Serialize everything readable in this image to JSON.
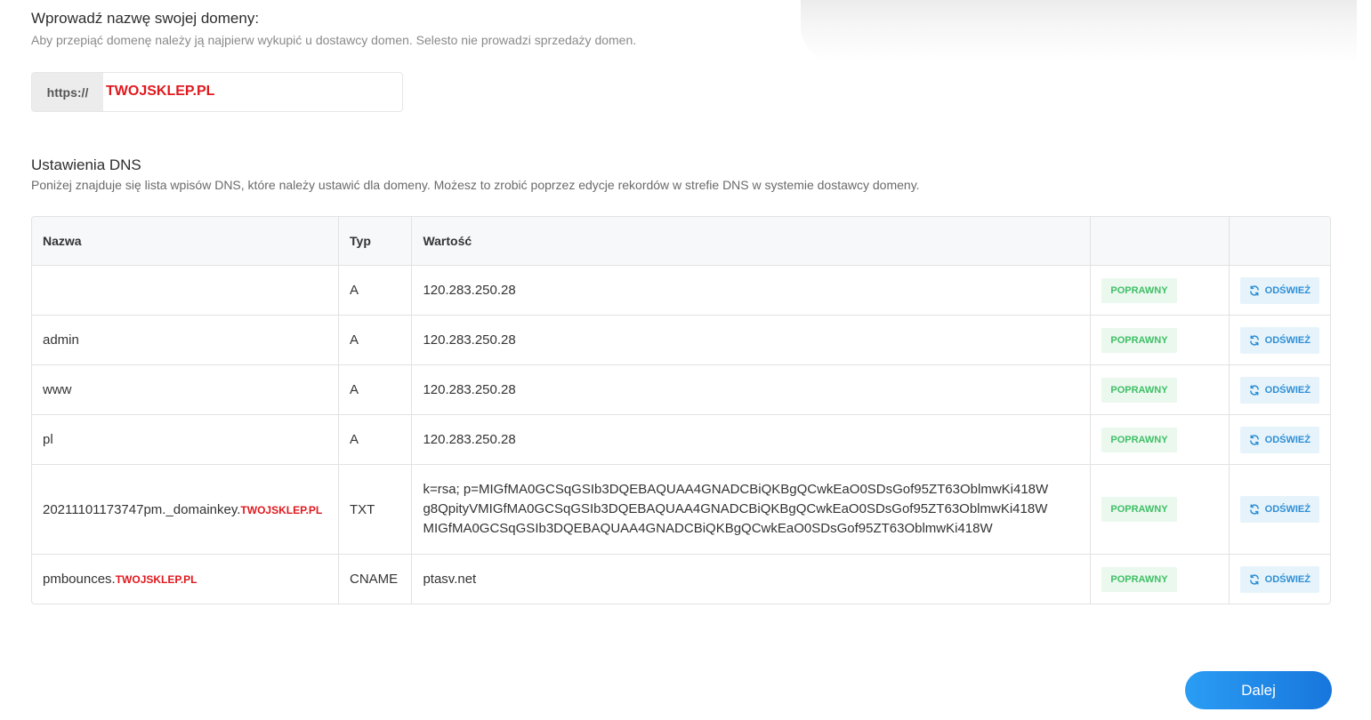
{
  "domain_section": {
    "title": "Wprowadź nazwę swojej domeny:",
    "subtitle": "Aby przepiąć domenę należy ją najpierw wykupić u dostawcy domen. Selesto nie prowadzi sprzedaży domen.",
    "prefix": "https://",
    "value": "TWOJSKLEP.PL"
  },
  "dns_section": {
    "title": "Ustawienia DNS",
    "subtitle": "Poniżej znajduje się lista wpisów DNS, które należy ustawić dla domeny. Możesz to zrobić poprzez edycje rekordów w strefie DNS w systemie dostawcy domeny.",
    "headers": {
      "name": "Nazwa",
      "type": "Typ",
      "value": "Wartość"
    },
    "rows": [
      {
        "name": "",
        "name_domain": "",
        "type": "A",
        "value_lines": [
          "120.283.250.28"
        ],
        "status": "POPRAWNY",
        "action": "ODŚWIEŻ"
      },
      {
        "name": "admin",
        "name_domain": "",
        "type": "A",
        "value_lines": [
          "120.283.250.28"
        ],
        "status": "POPRAWNY",
        "action": "ODŚWIEŻ"
      },
      {
        "name": "www",
        "name_domain": "",
        "type": "A",
        "value_lines": [
          "120.283.250.28"
        ],
        "status": "POPRAWNY",
        "action": "ODŚWIEŻ"
      },
      {
        "name": "pl",
        "name_domain": "",
        "type": "A",
        "value_lines": [
          "120.283.250.28"
        ],
        "status": "POPRAWNY",
        "action": "ODŚWIEŻ"
      },
      {
        "name": "20211101173747pm._domainkey.",
        "name_domain": "TWOJSKLEP.PL",
        "type": "TXT",
        "value_lines": [
          "k=rsa; p=MIGfMA0GCSqGSIb3DQEBAQUAA4GNADCBiQKBgQCwkEaO0SDsGof95ZT63OblmwKi418W",
          "g8QpityVMIGfMA0GCSqGSIb3DQEBAQUAA4GNADCBiQKBgQCwkEaO0SDsGof95ZT63OblmwKi418W",
          "MIGfMA0GCSqGSIb3DQEBAQUAA4GNADCBiQKBgQCwkEaO0SDsGof95ZT63OblmwKi418W"
        ],
        "status": "POPRAWNY",
        "action": "ODŚWIEŻ"
      },
      {
        "name": "pmbounces.",
        "name_domain": "TWOJSKLEP.PL",
        "type": "CNAME",
        "value_lines": [
          "ptasv.net"
        ],
        "status": "POPRAWNY",
        "action": "ODŚWIEŻ"
      }
    ]
  },
  "next_button": "Dalej",
  "colors": {
    "accent": "#1a8ae6",
    "domain_red": "#e0191e",
    "status_green": "#3fbf66",
    "status_bg": "#eaf8ee",
    "refresh_blue": "#2d8fd6",
    "refresh_bg": "#e6f3fb"
  },
  "icons": {
    "refresh": "refresh-icon"
  }
}
